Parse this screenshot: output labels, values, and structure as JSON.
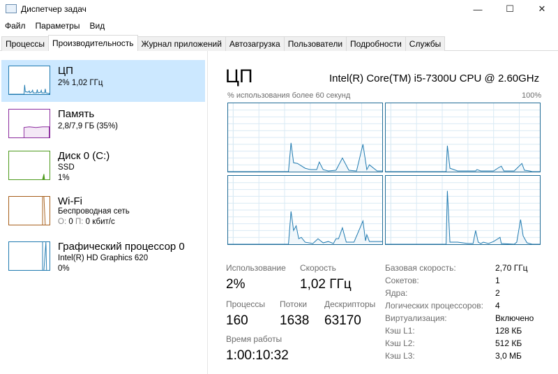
{
  "window": {
    "title": "Диспетчер задач",
    "minimize": "—",
    "maximize": "☐",
    "close": "✕"
  },
  "menu": [
    "Файл",
    "Параметры",
    "Вид"
  ],
  "tabs": [
    "Процессы",
    "Производительность",
    "Журнал приложений",
    "Автозагрузка",
    "Пользователи",
    "Подробности",
    "Службы"
  ],
  "sidebar": [
    {
      "title": "ЦП",
      "sub1": "2% 1,02 ГГц",
      "color": "#1f7ab0"
    },
    {
      "title": "Память",
      "sub1": "2,8/7,9 ГБ (35%)",
      "color": "#8b2b9e"
    },
    {
      "title": "Диск 0 (C:)",
      "sub1": "SSD",
      "sub2": "1%",
      "color": "#4d9a1c"
    },
    {
      "title": "Wi-Fi",
      "sub1": "Беспроводная сеть",
      "sub2_prefix1": "О:",
      "sub2_val1": "0",
      "sub2_prefix2": "П:",
      "sub2_val2": "0 кбит/с",
      "color": "#a65d18"
    },
    {
      "title": "Графический процессор 0",
      "sub1": "Intel(R) HD Graphics 620",
      "sub2": "0%",
      "color": "#1f7ab0"
    }
  ],
  "main": {
    "title": "ЦП",
    "cpu_name": "Intel(R) Core(TM) i5-7300U CPU @ 2.60GHz",
    "graph_label": "% использования более 60 секунд",
    "graph_max": "100%",
    "usage_label": "Использование",
    "usage": "2%",
    "speed_label": "Скорость",
    "speed": "1,02 ГГц",
    "processes_label": "Процессы",
    "processes": "160",
    "threads_label": "Потоки",
    "threads": "1638",
    "handles_label": "Дескрипторы",
    "handles": "63170",
    "uptime_label": "Время работы",
    "uptime": "1:00:10:32",
    "details": [
      {
        "label": "Базовая скорость:",
        "value": "2,70 ГГц"
      },
      {
        "label": "Сокетов:",
        "value": "1"
      },
      {
        "label": "Ядра:",
        "value": "2"
      },
      {
        "label": "Логических процессоров:",
        "value": "4"
      },
      {
        "label": "Виртуализация:",
        "value": "Включено"
      },
      {
        "label": "Кэш L1:",
        "value": "128 КБ"
      },
      {
        "label": "Кэш L2:",
        "value": "512 КБ"
      },
      {
        "label": "Кэш L3:",
        "value": "3,0 МБ"
      }
    ]
  },
  "chart_data": {
    "type": "line",
    "title": "% использования более 60 секунд",
    "xlim": [
      0,
      60
    ],
    "ylim": [
      0,
      100
    ],
    "series": [
      {
        "name": "core0",
        "points": [
          [
            0,
            0
          ],
          [
            23.5,
            0
          ],
          [
            24.5,
            42
          ],
          [
            25.5,
            13
          ],
          [
            27,
            12
          ],
          [
            30,
            5
          ],
          [
            32,
            3
          ],
          [
            34.5,
            3
          ],
          [
            35.5,
            14
          ],
          [
            37,
            3
          ],
          [
            39,
            1
          ],
          [
            42,
            2
          ],
          [
            44.5,
            20
          ],
          [
            47,
            2
          ],
          [
            50,
            1
          ],
          [
            52.5,
            40
          ],
          [
            54,
            3
          ],
          [
            55,
            10
          ],
          [
            58,
            1
          ],
          [
            60,
            1
          ]
        ]
      },
      {
        "name": "core1",
        "points": [
          [
            0,
            0
          ],
          [
            23.5,
            0
          ],
          [
            24,
            38
          ],
          [
            25,
            5
          ],
          [
            28,
            1
          ],
          [
            35,
            1
          ],
          [
            35.5,
            3
          ],
          [
            37,
            1
          ],
          [
            42,
            1
          ],
          [
            44,
            6
          ],
          [
            45,
            8
          ],
          [
            46,
            1
          ],
          [
            50,
            1
          ],
          [
            53,
            12
          ],
          [
            54,
            2
          ],
          [
            56,
            1
          ],
          [
            57,
            0
          ],
          [
            60,
            0
          ]
        ]
      },
      {
        "name": "core2",
        "points": [
          [
            0,
            0
          ],
          [
            23.5,
            0
          ],
          [
            24.5,
            48
          ],
          [
            25.5,
            20
          ],
          [
            26.5,
            27
          ],
          [
            27.5,
            8
          ],
          [
            28.5,
            10
          ],
          [
            30,
            3
          ],
          [
            33,
            1
          ],
          [
            35,
            8
          ],
          [
            37,
            2
          ],
          [
            39,
            4
          ],
          [
            41,
            1
          ],
          [
            42,
            8
          ],
          [
            43,
            8
          ],
          [
            44.5,
            24
          ],
          [
            46,
            3
          ],
          [
            49,
            3
          ],
          [
            52.5,
            34
          ],
          [
            53.5,
            5
          ],
          [
            54,
            14
          ],
          [
            55,
            4
          ],
          [
            58,
            4
          ],
          [
            60,
            4
          ]
        ]
      },
      {
        "name": "core3",
        "points": [
          [
            0,
            0
          ],
          [
            23.5,
            0
          ],
          [
            24,
            78
          ],
          [
            25,
            3
          ],
          [
            28,
            3
          ],
          [
            32,
            1
          ],
          [
            34,
            1
          ],
          [
            35,
            20
          ],
          [
            36,
            3
          ],
          [
            37,
            1
          ],
          [
            38,
            3
          ],
          [
            40,
            1
          ],
          [
            42,
            4
          ],
          [
            44.5,
            10
          ],
          [
            45,
            1
          ],
          [
            50,
            0
          ],
          [
            51,
            3
          ],
          [
            52.5,
            36
          ],
          [
            53.5,
            12
          ],
          [
            55,
            2
          ],
          [
            57,
            0
          ],
          [
            60,
            0
          ]
        ]
      }
    ]
  }
}
